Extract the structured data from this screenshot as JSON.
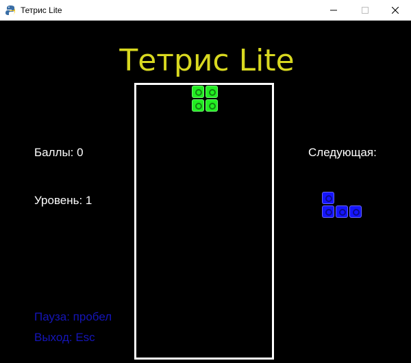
{
  "window": {
    "title": "Тетрис Lite",
    "icon": "python-snake-icon",
    "controls": [
      "minimize-icon",
      "maximize-icon",
      "close-icon"
    ]
  },
  "game": {
    "title": "Тетрис Lite",
    "score_label": "Баллы: 0",
    "level_label": "Уровень: 1",
    "next_label": "Следующая:",
    "pause_hint": "Пауза: пробел",
    "exit_hint": "Выход: Esc",
    "current_piece": {
      "type": "O",
      "color": "#22ee22",
      "cells": [
        [
          0,
          0
        ],
        [
          1,
          0
        ],
        [
          0,
          1
        ],
        [
          1,
          1
        ]
      ]
    },
    "next_piece": {
      "type": "J",
      "color": "#1515ff",
      "cells": [
        [
          0,
          0
        ],
        [
          0,
          1
        ],
        [
          1,
          1
        ],
        [
          2,
          1
        ]
      ]
    }
  },
  "colors": {
    "background": "#000000",
    "title": "#d8d820",
    "text": "#ffffff",
    "hint": "#1515b8",
    "well_border": "#ffffff"
  }
}
